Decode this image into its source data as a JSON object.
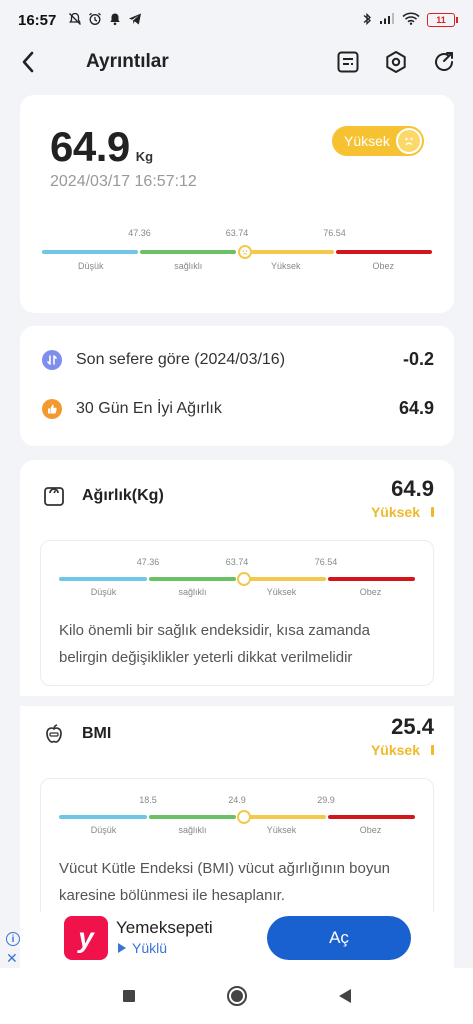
{
  "status_bar": {
    "time": "16:57",
    "battery": "11"
  },
  "header": {
    "title": "Ayrıntılar"
  },
  "main_card": {
    "weight": "64.9",
    "unit": "Kg",
    "datetime": "2024/03/17 16:57:12",
    "badge": "Yüksek",
    "scale": {
      "ticks": [
        "47.36",
        "63.74",
        "76.54"
      ],
      "labels": [
        "Düşük",
        "sağlıklı",
        "Yüksek",
        "Obez"
      ]
    }
  },
  "compare": {
    "rows": [
      {
        "label": "Son sefere göre (2024/03/16)",
        "value": "-0.2",
        "icon": "compare-icon"
      },
      {
        "label": "30 Gün En İyi Ağırlık",
        "value": "64.9",
        "icon": "thumbs-up-icon"
      }
    ]
  },
  "metrics": [
    {
      "name": "Ağırlık(Kg)",
      "value": "64.9",
      "status": "Yüksek",
      "icon": "scale-icon",
      "scale": {
        "ticks": [
          "47.36",
          "63.74",
          "76.54"
        ],
        "labels": [
          "Düşük",
          "sağlıklı",
          "Yüksek",
          "Obez"
        ]
      },
      "description": "Kilo önemli bir sağlık endeksidir, kısa zamanda belirgin değişiklikler yeterli dikkat verilmelidir"
    },
    {
      "name": "BMI",
      "value": "25.4",
      "status": "Yüksek",
      "icon": "apple-icon",
      "scale": {
        "ticks": [
          "18.5",
          "24.9",
          "29.9"
        ],
        "labels": [
          "Düşük",
          "sağlıklı",
          "Yüksek",
          "Obez"
        ]
      },
      "description": "Vücut Kütle Endeksi (BMI) vücut ağırlığının boyun karesine bölünmesi ile hesaplanır."
    }
  ],
  "ad": {
    "name": "Yemeksepeti",
    "sub": "Yüklü",
    "button": "Aç",
    "logo_letter": "y"
  },
  "colors": {
    "accent_yellow": "#f1c94d",
    "low_blue": "#6fc6e6",
    "healthy_green": "#6cc064",
    "obese_red": "#d3161c",
    "ad_button": "#1a61d0"
  }
}
